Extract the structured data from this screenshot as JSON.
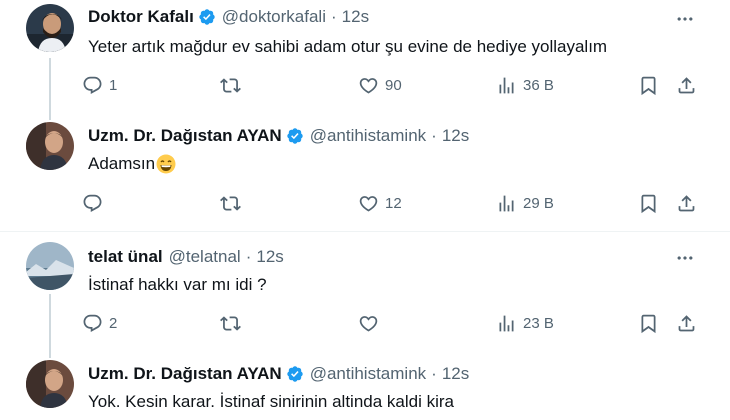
{
  "tweets": [
    {
      "name": "Doktor Kafalı",
      "handle": "@doktorkafali",
      "sep": "·",
      "time": "12s",
      "text": "Yeter artık mağdur ev sahibi adam otur şu evine de hediye yollayalım",
      "replies": "1",
      "retweets": "",
      "likes": "90",
      "views": "36 B"
    },
    {
      "name": "Uzm. Dr. Dağıstan AYAN",
      "handle": "@antihistamink",
      "sep": "·",
      "time": "12s",
      "text": "Adamsın",
      "emoji": "grinning-face-with-smiling-eyes",
      "replies": "",
      "retweets": "",
      "likes": "12",
      "views": "29 B"
    },
    {
      "name": "telat ünal",
      "handle": "@telatnal",
      "sep": "·",
      "time": "12s",
      "text": "İstinaf hakkı var mı idi ?",
      "replies": "2",
      "retweets": "",
      "likes": "",
      "views": "23 B"
    },
    {
      "name": "Uzm. Dr. Dağıstan AYAN",
      "handle": "@antihistamink",
      "sep": "·",
      "time": "12s",
      "text": "Yok. Kesin karar. İstinaf sinirinin altinda kaldi kira"
    }
  ],
  "colors": {
    "verified": "#1d9bf0",
    "text": "#0f1419",
    "secondary": "#536471",
    "thread_line": "#cfd9de"
  },
  "icons": {
    "reply": "reply-icon",
    "retweet": "retweet-icon",
    "like": "heart-icon",
    "views": "views-icon",
    "bookmark": "bookmark-icon",
    "share": "share-icon",
    "more": "more-icon",
    "verified": "verified-badge-icon"
  }
}
